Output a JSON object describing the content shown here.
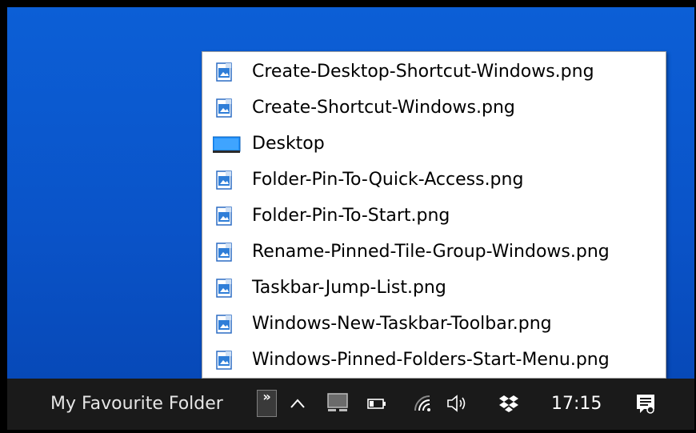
{
  "menu": {
    "items": [
      {
        "label": "Create-Desktop-Shortcut-Windows.png",
        "icon": "png-file-icon"
      },
      {
        "label": "Create-Shortcut-Windows.png",
        "icon": "png-file-icon"
      },
      {
        "label": "Desktop",
        "icon": "desktop-folder-icon"
      },
      {
        "label": "Folder-Pin-To-Quick-Access.png",
        "icon": "png-file-icon"
      },
      {
        "label": "Folder-Pin-To-Start.png",
        "icon": "png-file-icon"
      },
      {
        "label": "Rename-Pinned-Tile-Group-Windows.png",
        "icon": "png-file-icon"
      },
      {
        "label": "Taskbar-Jump-List.png",
        "icon": "png-file-icon"
      },
      {
        "label": "Windows-New-Taskbar-Toolbar.png",
        "icon": "png-file-icon"
      },
      {
        "label": "Windows-Pinned-Folders-Start-Menu.png",
        "icon": "png-file-icon"
      }
    ]
  },
  "taskbar": {
    "toolbar_label": "My Favourite Folder",
    "chevron_glyph": "»",
    "clock": "17:15",
    "tray_icons": [
      "show-hidden-icons-caret-icon",
      "network-monitor-icon",
      "battery-icon",
      "wifi-icon",
      "volume-icon",
      "dropbox-icon",
      "action-center-icon"
    ]
  },
  "colors": {
    "desktop": "#0a53c8",
    "taskbar": "#1a1a1a",
    "accent": "#0078d7"
  }
}
